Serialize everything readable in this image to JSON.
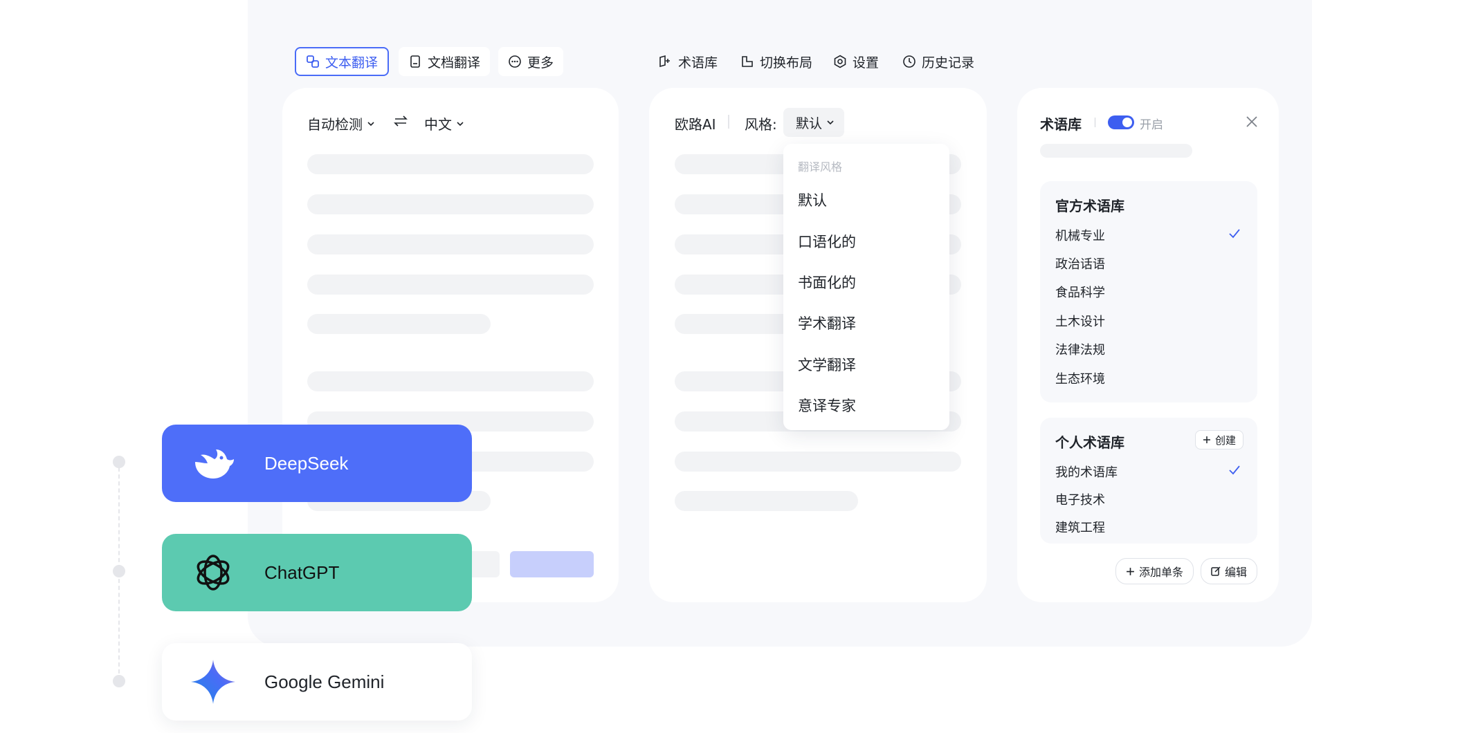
{
  "nav": {
    "text_translate": "文本翻译",
    "doc_translate": "文档翻译",
    "more": "更多",
    "glossary": "术语库",
    "switch_layout": "切换布局",
    "settings": "设置",
    "history": "历史记录"
  },
  "source": {
    "lang_from": "自动检测",
    "swap_icon": "swap-icon",
    "lang_to": "中文"
  },
  "target": {
    "engine": "欧路AI",
    "style_label": "风格:",
    "style_value": "默认"
  },
  "style_dropdown": {
    "title": "翻译风格",
    "options": [
      "默认",
      "口语化的",
      "书面化的",
      "学术翻译",
      "文学翻译",
      "意译专家"
    ]
  },
  "glossary_panel": {
    "title": "术语库",
    "toggle_label": "开启",
    "toggle_on": true,
    "official": {
      "title": "官方术语库",
      "items": [
        "机械专业",
        "政治话语",
        "食品科学",
        "土木设计",
        "法律法规",
        "生态环境"
      ],
      "checked_index": 0
    },
    "personal": {
      "title": "个人术语库",
      "create_label": "创建",
      "items": [
        "我的术语库",
        "电子技术",
        "建筑工程"
      ],
      "checked_index": 0
    },
    "add_entry_label": "添加单条",
    "edit_label": "编辑"
  },
  "models": [
    {
      "name": "DeepSeek",
      "color": "#4e6ef9",
      "text_color": "#ffffff",
      "icon": "whale-icon"
    },
    {
      "name": "ChatGPT",
      "color": "#5ccab0",
      "text_color": "#111111",
      "icon": "openai-icon"
    },
    {
      "name": "Google Gemini",
      "color": "#ffffff",
      "text_color": "#1f2329",
      "icon": "gemini-star-icon"
    }
  ],
  "colors": {
    "accent": "#4a6cf7",
    "translate_button": "#c7cffc"
  }
}
